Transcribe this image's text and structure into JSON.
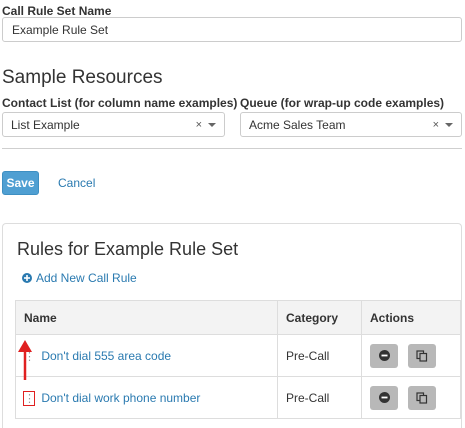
{
  "form": {
    "name_label": "Call Rule Set Name",
    "name_value": "Example Rule Set"
  },
  "sample": {
    "heading": "Sample Resources",
    "contact_label": "Contact List (for column name examples)",
    "contact_value": "List Example",
    "queue_label": "Queue (for wrap-up code examples)",
    "queue_value": "Acme Sales Team",
    "clear_glyph": "×"
  },
  "actions": {
    "save_label": "Save",
    "cancel_label": "Cancel"
  },
  "rules": {
    "heading": "Rules for Example Rule Set",
    "add_label": "Add New Call Rule",
    "columns": [
      "Name",
      "Category",
      "Actions"
    ],
    "rows": [
      {
        "name": "Don't dial 555 area code",
        "category": "Pre-Call"
      },
      {
        "name": "Don't dial work phone number",
        "category": "Pre-Call"
      }
    ]
  },
  "colors": {
    "accent": "#2a7ab0",
    "save": "#4f9fd2",
    "annotation": "#e02020"
  },
  "icons": [
    "add-circle-icon",
    "remove-icon",
    "copy-icon",
    "drag-handle-icon",
    "red-arrow-annotation"
  ]
}
